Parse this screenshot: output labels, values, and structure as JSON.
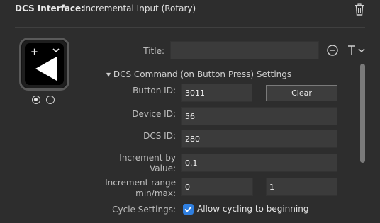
{
  "header": {
    "plugin_label": "DCS Interface:",
    "action_name": "Incremental Input (Rotary)"
  },
  "icons": {
    "trash": "trash-icon",
    "key_add": "plus-icon",
    "key_menu": "chevron-down-icon",
    "key_image": "play-left-icon",
    "title_align": "title-align-icon",
    "text_format": "text-format-icon"
  },
  "key_states": {
    "count": 2,
    "active_index": 0
  },
  "title": {
    "label": "Title:",
    "value": ""
  },
  "section": {
    "title": "DCS Command (on Button Press) Settings"
  },
  "fields": {
    "button_id": {
      "label": "Button ID:",
      "value": "3011"
    },
    "clear_button": "Clear",
    "device_id": {
      "label": "Device ID:",
      "value": "56"
    },
    "dcs_id": {
      "label": "DCS ID:",
      "value": "280"
    },
    "increment": {
      "label_line1": "Increment by",
      "label_line2": "Value:",
      "value": "0.1"
    },
    "increment_range": {
      "label_line1": "Increment range",
      "label_line2": "min/max:",
      "min": "0",
      "max": "1"
    },
    "cycle": {
      "label": "Cycle Settings:",
      "checkbox_label": "Allow cycling to beginning",
      "checked": true
    }
  },
  "colors": {
    "background": "#2d2d2d",
    "input_bg": "#3b3b3b",
    "checkbox_accent": "#2f7fe0"
  }
}
